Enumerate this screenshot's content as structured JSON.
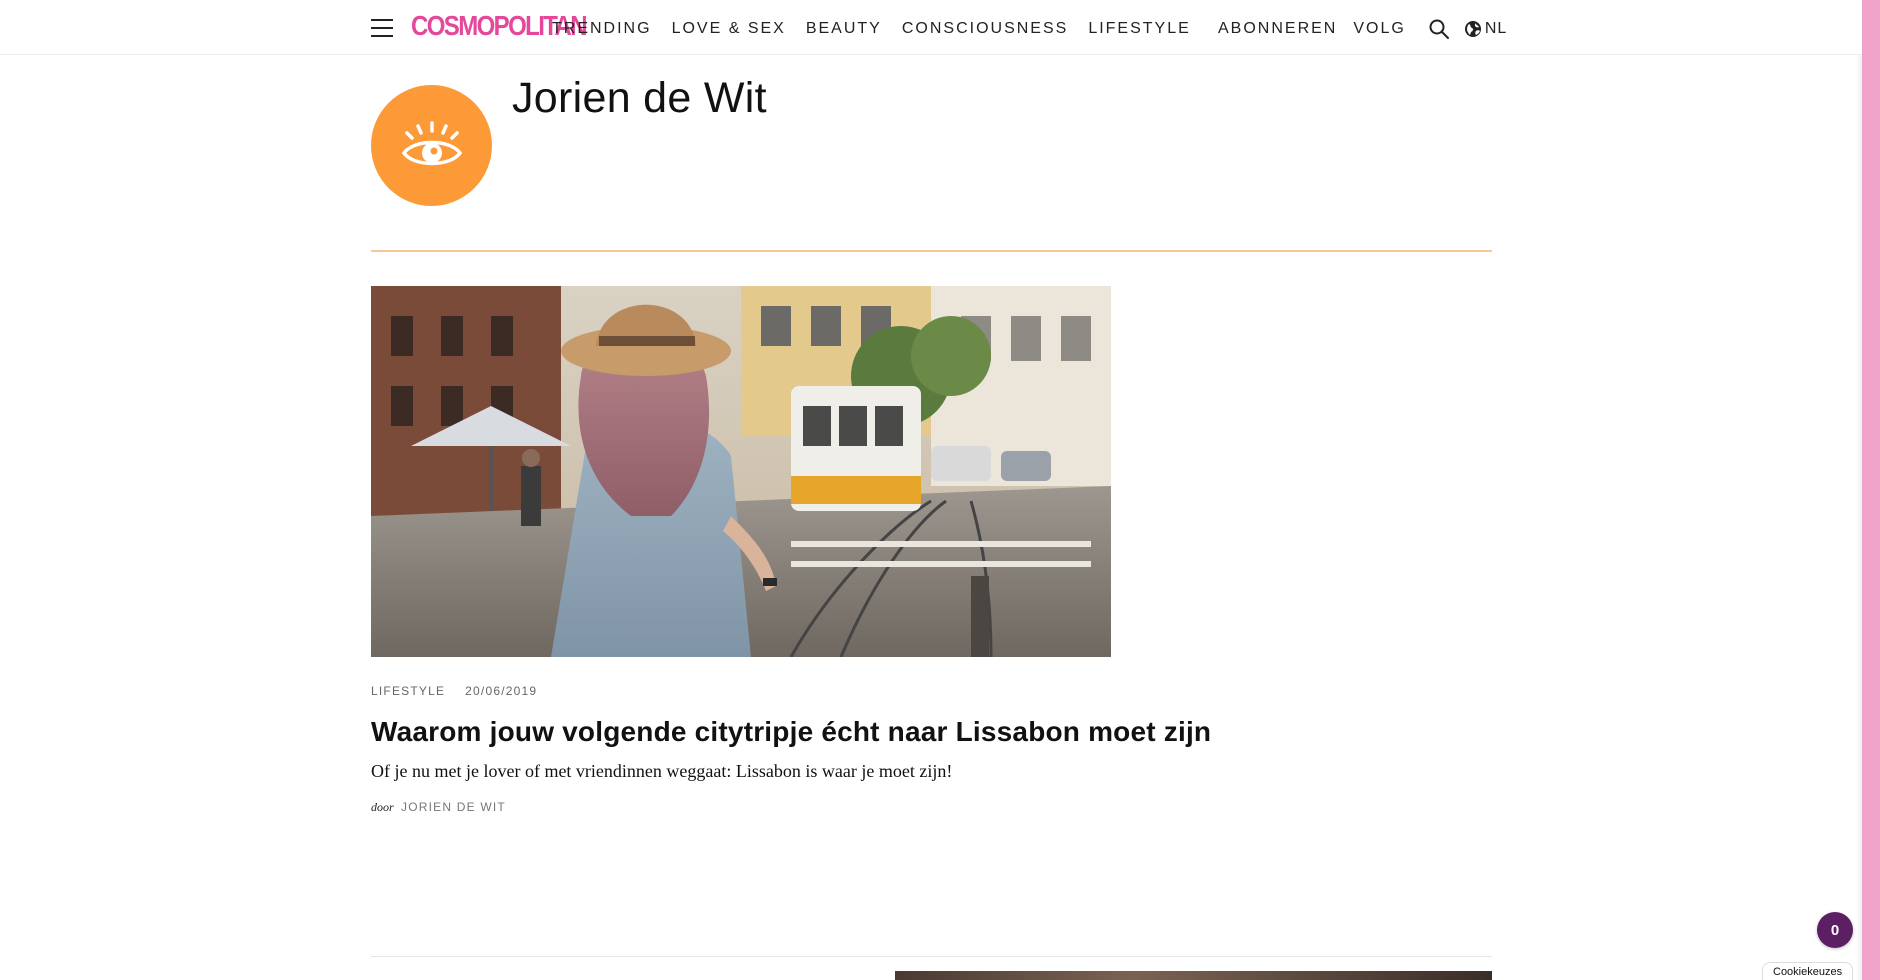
{
  "header": {
    "logo": "COSMOPOLITAN",
    "nav": [
      "TRENDING",
      "LOVE & SEX",
      "BEAUTY",
      "CONSCIOUSNESS",
      "LIFESTYLE"
    ],
    "subscribe_label": "ABONNEREN",
    "follow_label": "VOLG",
    "language_label": "NL"
  },
  "author": {
    "name": "Jorien de Wit",
    "avatar_icon": "eye-icon",
    "avatar_color": "#fc9a38"
  },
  "article": {
    "category": "LIFESTYLE",
    "date": "20/06/2019",
    "title": "Waarom jouw volgende citytripje écht naar Lissabon moet zijn",
    "excerpt": "Of je nu met je lover of met vriendinnen weggaat: Lissabon is waar je moet zijn!",
    "byline_prefix": "door",
    "byline_author": "JORIEN DE WIT"
  },
  "notification_count": "0",
  "cookie_label": "Cookiekeuzes",
  "colors": {
    "brand": "#e5479b",
    "accent_orange": "#fc9a38",
    "divider": "#f7c795",
    "badge": "#5c1f63",
    "side_stripe": "#f0a3c8"
  }
}
